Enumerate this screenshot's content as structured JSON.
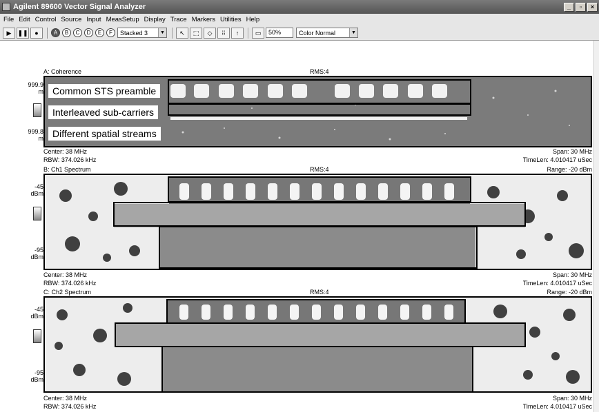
{
  "window": {
    "title": "Agilent 89600 Vector Signal Analyzer"
  },
  "menu": [
    "File",
    "Edit",
    "Control",
    "Source",
    "Input",
    "MeasSetup",
    "Display",
    "Trace",
    "Markers",
    "Utilities",
    "Help"
  ],
  "toolbar": {
    "traces": [
      "A",
      "B",
      "C",
      "D",
      "E",
      "F"
    ],
    "layout": "Stacked 3",
    "zoom": "50%",
    "color": "Color Normal"
  },
  "panels": [
    {
      "name": "A: Coherence",
      "rms": "RMS:4",
      "range": "",
      "y_top": "999.9",
      "y_top_unit": "m",
      "y_bottom": "999.8",
      "y_bottom_unit": "m",
      "center": "Center: 38 MHz",
      "rbw": "RBW: 374.026 kHz",
      "span": "Span: 30 MHz",
      "timelen": "TimeLen: 4.010417 uSec"
    },
    {
      "name": "B: Ch1 Spectrum",
      "rms": "RMS:4",
      "range": "Range: -20 dBm",
      "y_top": "-45",
      "y_top_unit": "dBm",
      "y_bottom": "-95",
      "y_bottom_unit": "dBm",
      "center": "Center: 38 MHz",
      "rbw": "RBW: 374.026 kHz",
      "span": "Span: 30 MHz",
      "timelen": "TimeLen: 4.010417 uSec"
    },
    {
      "name": "C: Ch2 Spectrum",
      "rms": "RMS:4",
      "range": "Range: -20 dBm",
      "y_top": "-45",
      "y_top_unit": "dBm",
      "y_bottom": "-95",
      "y_bottom_unit": "dBm",
      "center": "Center: 38 MHz",
      "rbw": "RBW: 374.026 kHz",
      "span": "Span: 30 MHz",
      "timelen": "TimeLen: 4.010417 uSec"
    }
  ],
  "annotations": {
    "preamble": "Common STS preamble",
    "subcarriers": "Interleaved sub-carriers",
    "streams": "Different spatial streams"
  },
  "colors": {
    "coherence_bg": "#7a7a7a",
    "dark": "#222222",
    "light": "#f2f2f2"
  }
}
